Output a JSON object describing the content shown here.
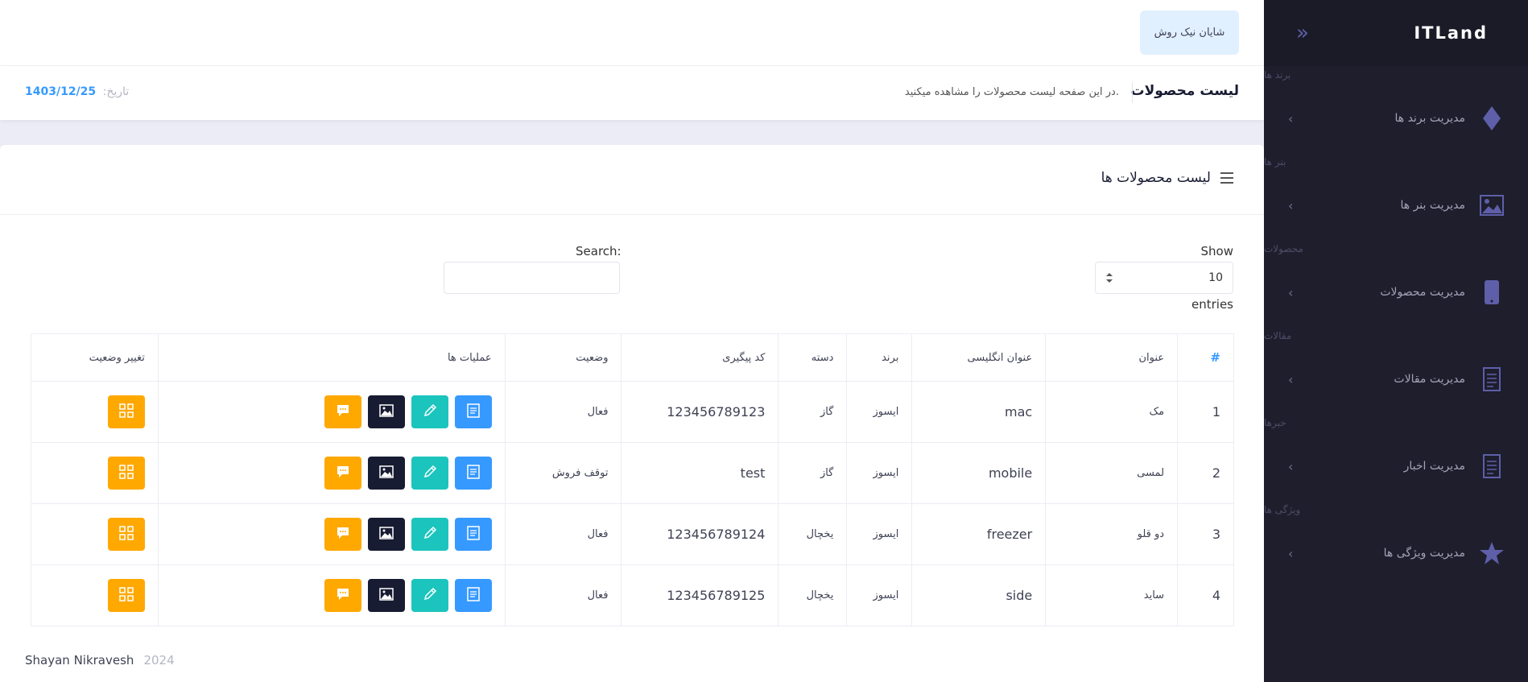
{
  "sidebar": {
    "logo": "ITLand",
    "toggle": "»",
    "sections": [
      {
        "heading": "برند ها",
        "label": "مدیریت برند ها",
        "icon": "diamond-icon"
      },
      {
        "heading": "بنر ها",
        "label": "مدیریت بنر ها",
        "icon": "image-icon"
      },
      {
        "heading": "محصولات",
        "label": "مدیریت محصولات",
        "icon": "mobile-icon"
      },
      {
        "heading": "مقالات",
        "label": "مدیریت مقالات",
        "icon": "document-icon"
      },
      {
        "heading": "خبرها",
        "label": "مدیریت اخبار",
        "icon": "news-icon"
      },
      {
        "heading": "ویژگی ها",
        "label": "مدیریت ویژگی ها",
        "icon": "star-icon"
      }
    ]
  },
  "topbar": {
    "user_name": "شایان نیک روش"
  },
  "subheader": {
    "title": "لیست محصولات",
    "description": "در این صفحه لیست محصولات را مشاهده میکنید.",
    "date_label": "تاریخ:",
    "date_value": "1403/12/25"
  },
  "card": {
    "title": "لیست محصولات ها",
    "show_label": "Show",
    "entries_value": "10",
    "entries_label": "entries",
    "search_label": "Search:"
  },
  "table": {
    "headers": [
      "#",
      "عنوان",
      "عنوان انگلیسی",
      "برند",
      "دسته",
      "کد پیگیری",
      "وضعیت",
      "عملیات ها",
      "تغییر وضعیت"
    ],
    "rows": [
      {
        "num": "1",
        "title": "مک",
        "en_title": "mac",
        "brand": "ایسوز",
        "category": "گاز",
        "code": "123456789123",
        "status": "فعال"
      },
      {
        "num": "2",
        "title": "لمسی",
        "en_title": "mobile",
        "brand": "ایسوز",
        "category": "گاز",
        "code": "test",
        "status": "توقف فروش"
      },
      {
        "num": "3",
        "title": "دو قلو",
        "en_title": "freezer",
        "brand": "ایسوز",
        "category": "یخچال",
        "code": "123456789124",
        "status": "فعال"
      },
      {
        "num": "4",
        "title": "ساید",
        "en_title": "side",
        "brand": "ایسوز",
        "category": "یخچال",
        "code": "123456789125",
        "status": "فعال"
      }
    ]
  },
  "footer": {
    "name": "Shayan Nikravesh",
    "year": "2024"
  },
  "colors": {
    "blue": "#3699ff",
    "teal": "#1bc5bd",
    "dark": "#181c32",
    "amber": "#ffa800",
    "sidebar": "#1e1e2d"
  }
}
